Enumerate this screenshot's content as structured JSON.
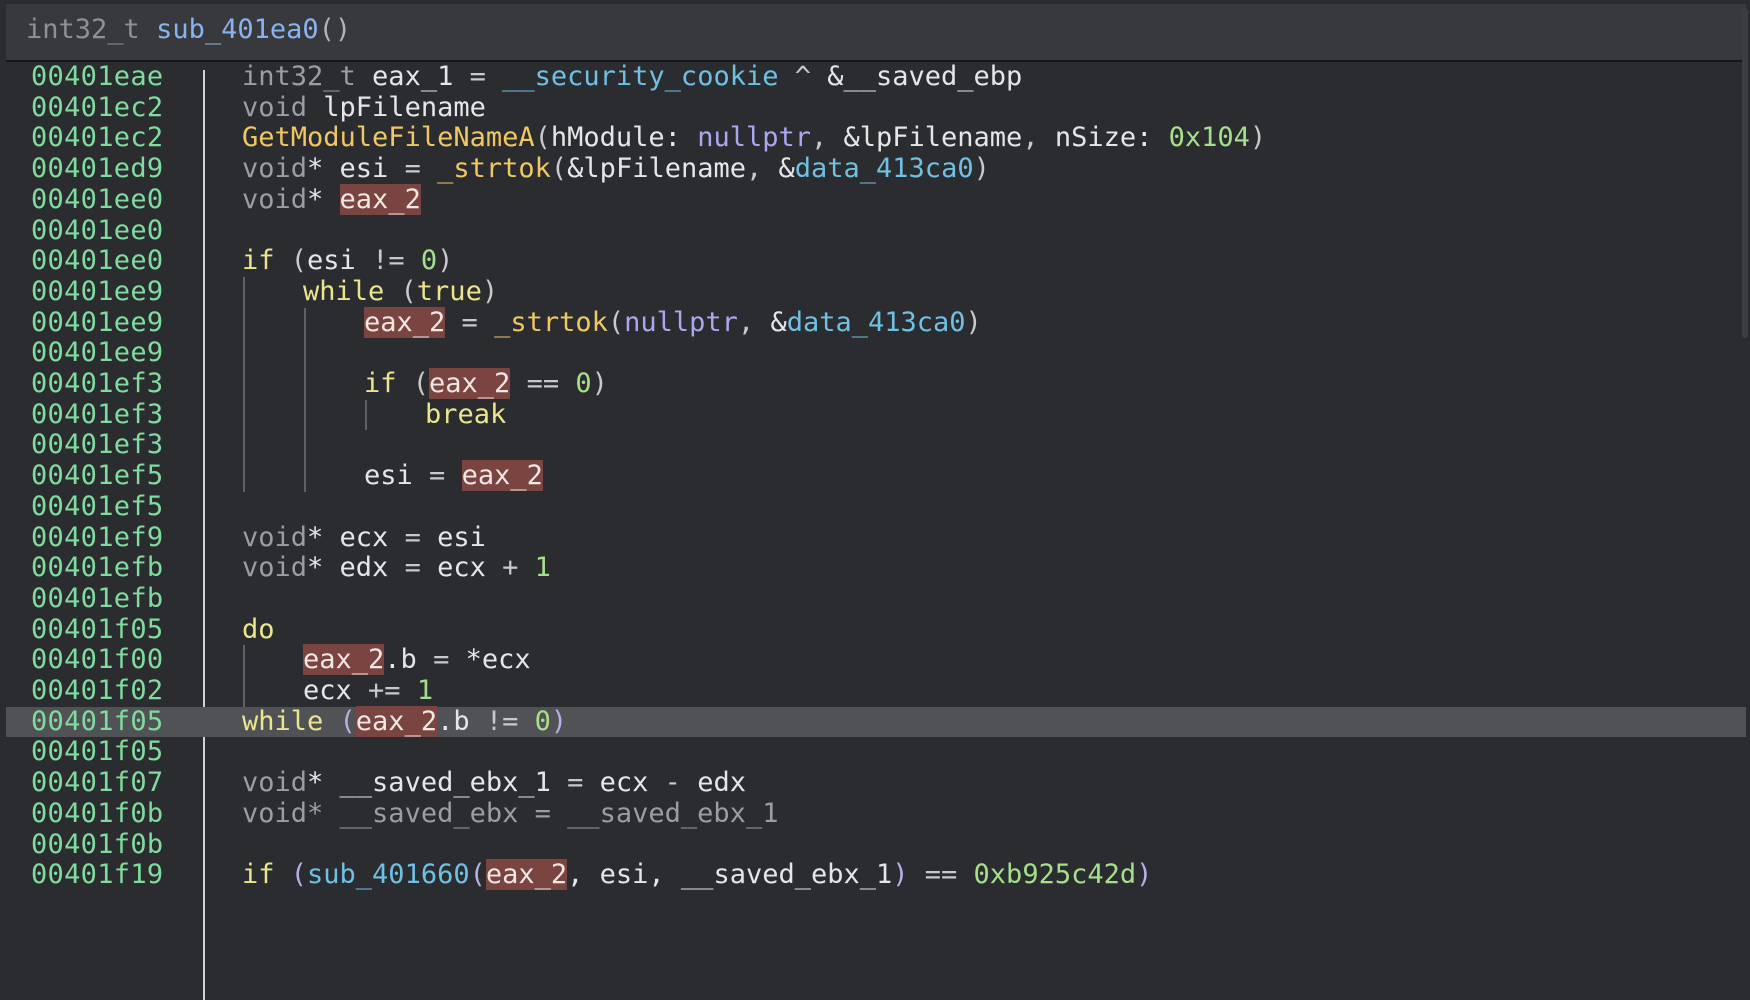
{
  "header": {
    "return_type": "int32_t",
    "function_name": "sub_401ea0",
    "parens": "()"
  },
  "lines": [
    {
      "addr": "00401eae",
      "indent": 0,
      "tokens": [
        [
          "int32_t",
          "type"
        ],
        [
          " eax_1 ",
          "var"
        ],
        [
          "=",
          "op"
        ],
        [
          " ",
          "var"
        ],
        [
          "__security_cookie",
          "glob"
        ],
        [
          " ^ ",
          "op"
        ],
        [
          "&__saved_ebp",
          "var"
        ]
      ]
    },
    {
      "addr": "00401ec2",
      "indent": 0,
      "tokens": [
        [
          "void",
          "type"
        ],
        [
          " lpFilename",
          "var"
        ]
      ]
    },
    {
      "addr": "00401ec2",
      "indent": 0,
      "tokens": [
        [
          "GetModuleFileNameA",
          "fn"
        ],
        [
          "(",
          "p"
        ],
        [
          "hModule: ",
          "var"
        ],
        [
          "nullptr",
          "const"
        ],
        [
          ", ",
          "op"
        ],
        [
          "&lpFilename",
          "var"
        ],
        [
          ", ",
          "op"
        ],
        [
          "nSize: ",
          "var"
        ],
        [
          "0x104",
          "num"
        ],
        [
          ")",
          "p"
        ]
      ]
    },
    {
      "addr": "00401ed9",
      "indent": 0,
      "tokens": [
        [
          "void",
          "type"
        ],
        [
          "* esi ",
          "var"
        ],
        [
          "=",
          "op"
        ],
        [
          " ",
          "var"
        ],
        [
          "_strtok",
          "fn"
        ],
        [
          "(",
          "p"
        ],
        [
          "&lpFilename",
          "var"
        ],
        [
          ", ",
          "op"
        ],
        [
          "&",
          "var"
        ],
        [
          "data_413ca0",
          "glob"
        ],
        [
          ")",
          "p"
        ]
      ]
    },
    {
      "addr": "00401ee0",
      "indent": 0,
      "tokens": [
        [
          "void",
          "type"
        ],
        [
          "* ",
          "var"
        ],
        [
          "eax_2",
          "hl"
        ]
      ]
    },
    {
      "addr": "00401ee0",
      "indent": 0,
      "tokens": []
    },
    {
      "addr": "00401ee0",
      "indent": 0,
      "tokens": [
        [
          "if",
          "kw"
        ],
        [
          " (",
          "p"
        ],
        [
          "esi ",
          "var"
        ],
        [
          "!=",
          "op"
        ],
        [
          " ",
          "var"
        ],
        [
          "0",
          "num"
        ],
        [
          ")",
          "p"
        ]
      ]
    },
    {
      "addr": "00401ee9",
      "indent": 1,
      "tokens": [
        [
          "while",
          "kw"
        ],
        [
          " (",
          "p"
        ],
        [
          "true",
          "kw"
        ],
        [
          ")",
          "p"
        ]
      ]
    },
    {
      "addr": "00401ee9",
      "indent": 2,
      "tokens": [
        [
          "eax_2",
          "hl"
        ],
        [
          " = ",
          "op"
        ],
        [
          "_strtok",
          "fn"
        ],
        [
          "(",
          "p"
        ],
        [
          "nullptr",
          "const"
        ],
        [
          ", ",
          "op"
        ],
        [
          "&",
          "var"
        ],
        [
          "data_413ca0",
          "glob"
        ],
        [
          ")",
          "p"
        ]
      ]
    },
    {
      "addr": "00401ee9",
      "indent": 2,
      "tokens": []
    },
    {
      "addr": "00401ef3",
      "indent": 2,
      "tokens": [
        [
          "if",
          "kw"
        ],
        [
          " (",
          "p"
        ],
        [
          "eax_2",
          "hl"
        ],
        [
          " == ",
          "op"
        ],
        [
          "0",
          "num"
        ],
        [
          ")",
          "p"
        ]
      ]
    },
    {
      "addr": "00401ef3",
      "indent": 3,
      "tokens": [
        [
          "break",
          "kw"
        ]
      ]
    },
    {
      "addr": "00401ef3",
      "indent": 2,
      "tokens": []
    },
    {
      "addr": "00401ef5",
      "indent": 2,
      "tokens": [
        [
          "esi ",
          "var"
        ],
        [
          "=",
          "op"
        ],
        [
          " ",
          "var"
        ],
        [
          "eax_2",
          "hl"
        ]
      ]
    },
    {
      "addr": "00401ef5",
      "indent": 0,
      "tokens": []
    },
    {
      "addr": "00401ef9",
      "indent": 0,
      "tokens": [
        [
          "void",
          "type"
        ],
        [
          "* ecx ",
          "var"
        ],
        [
          "=",
          "op"
        ],
        [
          " esi",
          "var"
        ]
      ]
    },
    {
      "addr": "00401efb",
      "indent": 0,
      "tokens": [
        [
          "void",
          "type"
        ],
        [
          "* edx ",
          "var"
        ],
        [
          "=",
          "op"
        ],
        [
          " ecx ",
          "var"
        ],
        [
          "+",
          "op"
        ],
        [
          " ",
          "var"
        ],
        [
          "1",
          "num"
        ]
      ]
    },
    {
      "addr": "00401efb",
      "indent": 0,
      "tokens": []
    },
    {
      "addr": "00401f05",
      "indent": 0,
      "tokens": [
        [
          "do",
          "kw"
        ]
      ]
    },
    {
      "addr": "00401f00",
      "indent": 1,
      "tokens": [
        [
          "eax_2",
          "hl"
        ],
        [
          ".b ",
          "var"
        ],
        [
          "=",
          "op"
        ],
        [
          " *ecx",
          "var"
        ]
      ]
    },
    {
      "addr": "00401f02",
      "indent": 1,
      "tokens": [
        [
          "ecx ",
          "var"
        ],
        [
          "+=",
          "op"
        ],
        [
          " ",
          "var"
        ],
        [
          "1",
          "num"
        ]
      ]
    },
    {
      "addr": "00401f05",
      "indent": 0,
      "current": true,
      "tokens": [
        [
          "while",
          "kw"
        ],
        [
          " (",
          "p2"
        ],
        [
          "eax_2",
          "hl"
        ],
        [
          ".b ",
          "var"
        ],
        [
          "!=",
          "op"
        ],
        [
          " ",
          "var"
        ],
        [
          "0",
          "num"
        ],
        [
          ")",
          "p2"
        ]
      ]
    },
    {
      "addr": "00401f05",
      "indent": 0,
      "tokens": []
    },
    {
      "addr": "00401f07",
      "indent": 0,
      "tokens": [
        [
          "void",
          "type"
        ],
        [
          "* __saved_ebx_1 ",
          "var"
        ],
        [
          "=",
          "op"
        ],
        [
          " ecx ",
          "var"
        ],
        [
          "-",
          "op"
        ],
        [
          " edx",
          "var"
        ]
      ]
    },
    {
      "addr": "00401f0b",
      "indent": 0,
      "tokens": [
        [
          "void",
          "type"
        ],
        [
          "* __saved_ebx ",
          "type"
        ],
        [
          "=",
          "type"
        ],
        [
          " __saved_ebx_1",
          "type"
        ]
      ]
    },
    {
      "addr": "00401f0b",
      "indent": 0,
      "tokens": []
    },
    {
      "addr": "00401f19",
      "indent": 0,
      "tokens": [
        [
          "if",
          "kw"
        ],
        [
          " (",
          "p2"
        ],
        [
          "sub_401660",
          "glob"
        ],
        [
          "(",
          "p2"
        ],
        [
          "eax_2",
          "hl"
        ],
        [
          ", esi, __saved_ebx_1",
          "var"
        ],
        [
          ")",
          "p2"
        ],
        [
          " == ",
          "op"
        ],
        [
          "0xb925c42d",
          "num"
        ],
        [
          ")",
          "p2"
        ]
      ]
    }
  ]
}
